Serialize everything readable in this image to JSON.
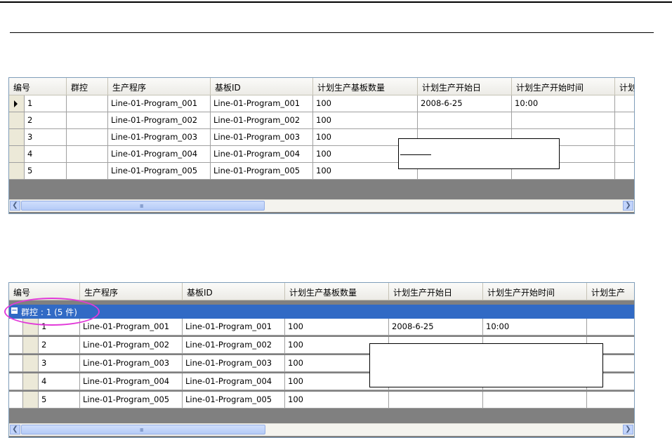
{
  "grid1": {
    "columns": [
      "编号",
      "群控",
      "生产程序",
      "基板ID",
      "计划生产基板数量",
      "计划生产开始日",
      "计划生产开始时间",
      "计划"
    ],
    "rows": [
      {
        "no": "1",
        "group": "",
        "program": "Line-01-Program_001",
        "board_id": "Line-01-Program_001",
        "qty": "100",
        "start_date": "2008-6-25",
        "start_time": "10:00",
        "selected": true
      },
      {
        "no": "2",
        "group": "",
        "program": "Line-01-Program_002",
        "board_id": "Line-01-Program_002",
        "qty": "100",
        "start_date": "",
        "start_time": "",
        "selected": false
      },
      {
        "no": "3",
        "group": "",
        "program": "Line-01-Program_003",
        "board_id": "Line-01-Program_003",
        "qty": "100",
        "start_date": "",
        "start_time": "",
        "selected": false
      },
      {
        "no": "4",
        "group": "",
        "program": "Line-01-Program_004",
        "board_id": "Line-01-Program_004",
        "qty": "100",
        "start_date": "",
        "start_time": "",
        "selected": false
      },
      {
        "no": "5",
        "group": "",
        "program": "Line-01-Program_005",
        "board_id": "Line-01-Program_005",
        "qty": "100",
        "start_date": "",
        "start_time": "",
        "selected": false
      }
    ],
    "scroll_grip": "IIII"
  },
  "grid2": {
    "columns": [
      "编号",
      "生产程序",
      "基板ID",
      "计划生产基板数量",
      "计划生产开始日",
      "计划生产开始时间",
      "计划生产"
    ],
    "group_label": "群控 : 1 (5 件)",
    "group_toggle": "−",
    "rows": [
      {
        "no": "1",
        "program": "Line-01-Program_001",
        "board_id": "Line-01-Program_001",
        "qty": "100",
        "start_date": "2008-6-25",
        "start_time": "10:00"
      },
      {
        "no": "2",
        "program": "Line-01-Program_002",
        "board_id": "Line-01-Program_002",
        "qty": "100",
        "start_date": "",
        "start_time": ""
      },
      {
        "no": "3",
        "program": "Line-01-Program_003",
        "board_id": "Line-01-Program_003",
        "qty": "100",
        "start_date": "",
        "start_time": ""
      },
      {
        "no": "4",
        "program": "Line-01-Program_004",
        "board_id": "Line-01-Program_004",
        "qty": "100",
        "start_date": "",
        "start_time": ""
      },
      {
        "no": "5",
        "program": "Line-01-Program_005",
        "board_id": "Line-01-Program_005",
        "qty": "100",
        "start_date": "",
        "start_time": ""
      }
    ],
    "scroll_grip": "IIII"
  },
  "scroll_left_icon": "left-arrow-icon",
  "scroll_right_icon": "right-arrow-icon"
}
